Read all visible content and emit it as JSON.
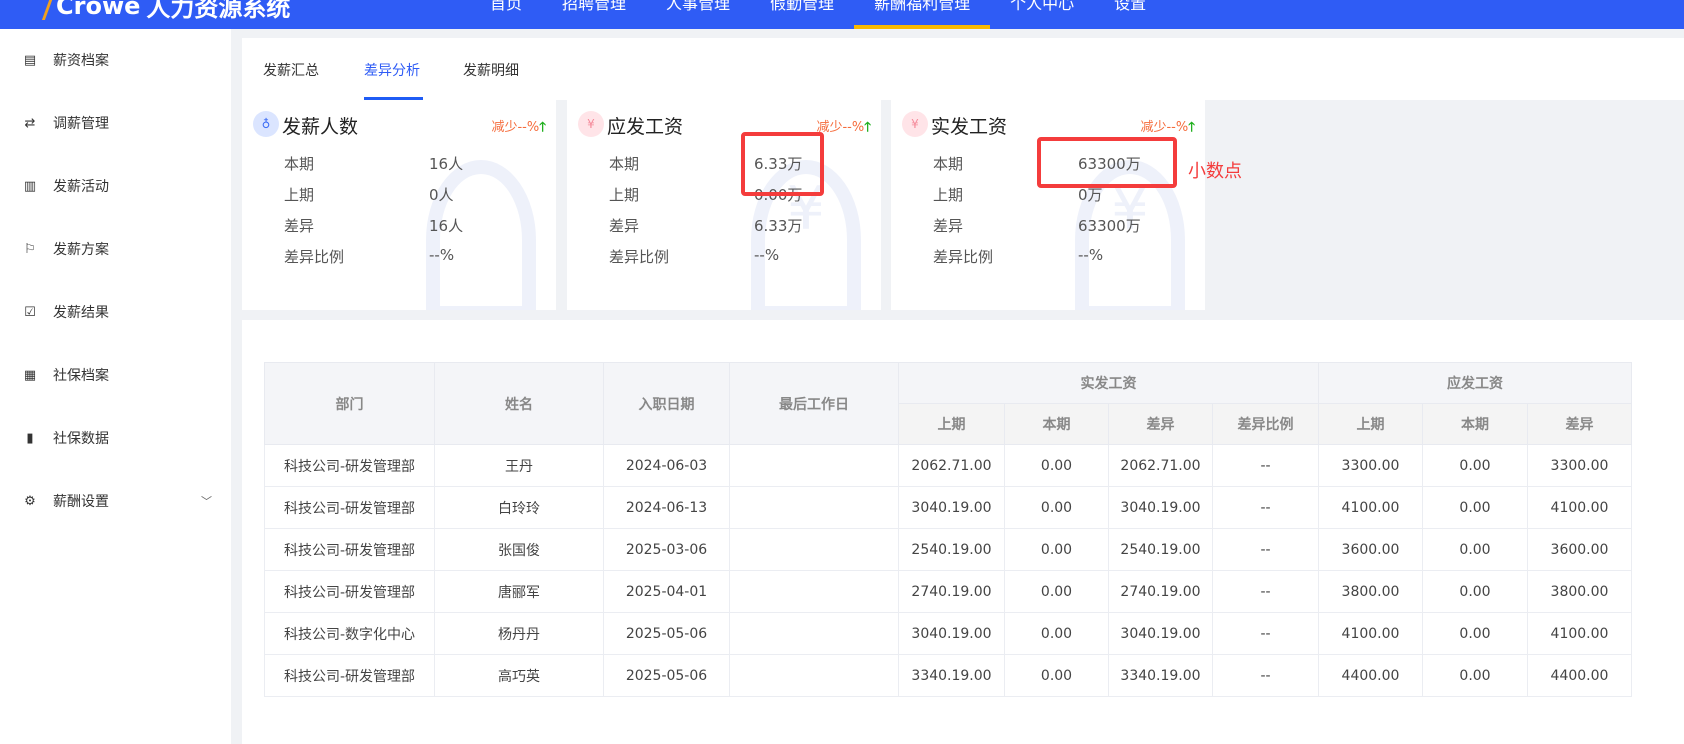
{
  "header": {
    "logo": "Crowe",
    "system_name": "人力资源系统",
    "nav": [
      "首页",
      "招聘管理",
      "人事管理",
      "假勤管理",
      "薪酬福利管理",
      "个人中心",
      "设置"
    ],
    "active_nav": 4
  },
  "sidebar": {
    "items": [
      {
        "label": "薪资档案",
        "icon": "file-icon"
      },
      {
        "label": "调薪管理",
        "icon": "exchange-icon"
      },
      {
        "label": "发薪活动",
        "icon": "clipboard-icon"
      },
      {
        "label": "发薪方案",
        "icon": "flag-icon"
      },
      {
        "label": "发薪结果",
        "icon": "check-clipboard-icon"
      },
      {
        "label": "社保档案",
        "icon": "archive-icon"
      },
      {
        "label": "社保数据",
        "icon": "bar-chart-icon"
      },
      {
        "label": "薪酬设置",
        "icon": "gear-icon"
      }
    ]
  },
  "tabs": [
    "发薪汇总",
    "差异分析",
    "发薪明细"
  ],
  "active_tab": 1,
  "cards": [
    {
      "title": "发薪人数",
      "trend": "减少--%",
      "rows": [
        {
          "label": "本期",
          "value": "16人"
        },
        {
          "label": "上期",
          "value": "0人"
        },
        {
          "label": "差异",
          "value": "16人"
        },
        {
          "label": "差异比例",
          "value": "--%"
        }
      ]
    },
    {
      "title": "应发工资",
      "trend": "减少--%",
      "rows": [
        {
          "label": "本期",
          "value": "6.33万"
        },
        {
          "label": "上期",
          "value": "0.00万"
        },
        {
          "label": "差异",
          "value": "6.33万"
        },
        {
          "label": "差异比例",
          "value": "--%"
        }
      ]
    },
    {
      "title": "实发工资",
      "trend": "减少--%",
      "rows": [
        {
          "label": "本期",
          "value": "63300万"
        },
        {
          "label": "上期",
          "value": "0万"
        },
        {
          "label": "差异",
          "value": "63300万"
        },
        {
          "label": "差异比例",
          "value": "--%"
        }
      ]
    }
  ],
  "annotation": "小数点",
  "table": {
    "headers": {
      "dept": "部门",
      "name": "姓名",
      "hire": "入职日期",
      "last": "最后工作日",
      "group1": "实发工资",
      "group2": "应发工资",
      "sub": [
        "上期",
        "本期",
        "差异",
        "差异比例",
        "上期",
        "本期",
        "差异"
      ]
    },
    "rows": [
      [
        "科技公司-研发管理部",
        "王丹",
        "2024-06-03",
        "",
        "2062.71.00",
        "0.00",
        "2062.71.00",
        "--",
        "3300.00",
        "0.00",
        "3300.00"
      ],
      [
        "科技公司-研发管理部",
        "白玲玲",
        "2024-06-13",
        "",
        "3040.19.00",
        "0.00",
        "3040.19.00",
        "--",
        "4100.00",
        "0.00",
        "4100.00"
      ],
      [
        "科技公司-研发管理部",
        "张国俊",
        "2025-03-06",
        "",
        "2540.19.00",
        "0.00",
        "2540.19.00",
        "--",
        "3600.00",
        "0.00",
        "3600.00"
      ],
      [
        "科技公司-研发管理部",
        "唐郦军",
        "2025-04-01",
        "",
        "2740.19.00",
        "0.00",
        "2740.19.00",
        "--",
        "3800.00",
        "0.00",
        "3800.00"
      ],
      [
        "科技公司-数字化中心",
        "杨丹丹",
        "2025-05-06",
        "",
        "3040.19.00",
        "0.00",
        "3040.19.00",
        "--",
        "4100.00",
        "0.00",
        "4100.00"
      ],
      [
        "科技公司-研发管理部",
        "高巧英",
        "2025-05-06",
        "",
        "3340.19.00",
        "0.00",
        "3340.19.00",
        "--",
        "4400.00",
        "0.00",
        "4400.00"
      ]
    ]
  }
}
